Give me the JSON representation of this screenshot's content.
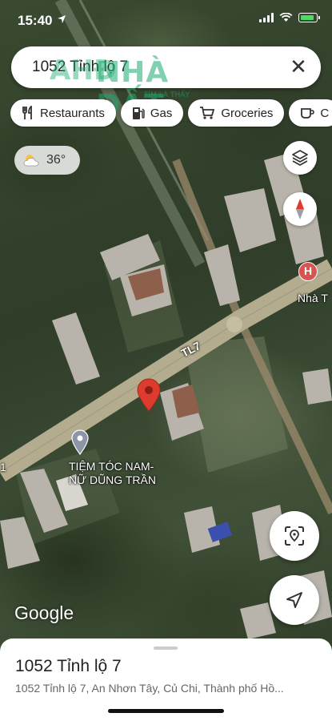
{
  "status_bar": {
    "time": "15:40",
    "location_arrow": "location-arrow-icon",
    "battery_color": "#4cd964"
  },
  "search": {
    "value": "1052 Tỉnh lộ 7",
    "close_icon": "close-icon"
  },
  "watermark": {
    "logo": "AHĐ",
    "brand": "NHÀ ĐẤT",
    "tagline": "TÌM LÀ THẤY",
    "color": "#1aaa6e"
  },
  "chips": [
    {
      "label": "Restaurants",
      "icon": "fork-knife-icon"
    },
    {
      "label": "Gas",
      "icon": "gas-pump-icon"
    },
    {
      "label": "Groceries",
      "icon": "cart-icon"
    },
    {
      "label": "C",
      "icon": "coffee-icon"
    }
  ],
  "weather": {
    "temperature": "36°",
    "icon": "partly-cloudy-icon"
  },
  "map": {
    "road_label": "TL7",
    "place_label": "TIỆM TÓC NAM-\nNỮ DŨNG TRẦN",
    "poi_label": "Nhà T",
    "edge_label": "1",
    "attribution": "Google",
    "pin_color": "#dd3b2d",
    "hospital_color": "#d9534f"
  },
  "controls": {
    "layers_icon": "layers-icon",
    "compass_icon": "compass-icon",
    "search_area_icon": "explore-area-icon",
    "directions_icon": "navigation-arrow-icon"
  },
  "bottom_sheet": {
    "title": "1052 Tỉnh lộ 7",
    "address": "1052 Tỉnh lộ 7, An Nhơn Tây, Củ Chi, Thành phố Hồ..."
  }
}
